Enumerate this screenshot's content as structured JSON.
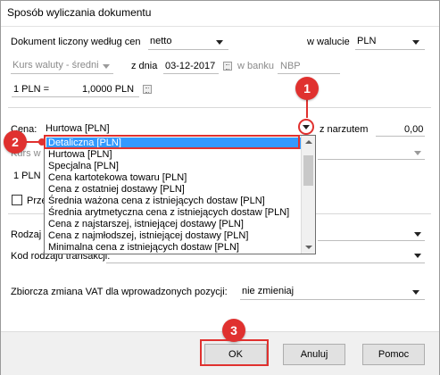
{
  "window": {
    "title": "Sposób wyliczania dokumentu"
  },
  "row1": {
    "label": "Dokument liczony według cen",
    "mode_value": "netto",
    "currency_label": "w walucie",
    "currency_value": "PLN"
  },
  "row2": {
    "rate_type_value": "Kurs waluty - średni",
    "date_label": "z dnia",
    "date_value": "03-12-2017",
    "bank_label": "w banku",
    "bank_value": "NBP"
  },
  "row3": {
    "rate_left": "1 PLN =",
    "rate_value": "1,0000 PLN"
  },
  "price": {
    "label": "Cena:",
    "value": "Hurtowa [PLN]",
    "markup_label": "z narzutem",
    "markup_value": "0,00"
  },
  "hidden_rows": {
    "kurs_partial": "Kurs w",
    "rate_partial": "1 PLN =",
    "checkbox_partial": "Prze",
    "rodzaj_partial": "Rodzaj",
    "kod_label": "Kod rodzaju transakcji:"
  },
  "dropdown": {
    "items": [
      "Detaliczna [PLN]",
      "Hurtowa [PLN]",
      "Specjalna [PLN]",
      "Cena kartotekowa towaru [PLN]",
      "Cena z ostatniej dostawy [PLN]",
      "Średnia ważona cena z istniejących dostaw [PLN]",
      "Średnia arytmetyczna cena z istniejących dostaw [PLN]",
      "Cena z najstarszej, istniejącej dostawy [PLN]",
      "Cena z najmłodszej, istniejącej dostawy [PLN]",
      "Minimalna cena z istniejących dostaw [PLN]"
    ],
    "selected_index": 0
  },
  "vat": {
    "label": "Zbiorcza zmiana VAT dla wprowadzonych pozycji:",
    "value": "nie zmieniaj"
  },
  "buttons": {
    "ok": "OK",
    "cancel": "Anuluj",
    "help": "Pomoc"
  },
  "annotations": {
    "m1": "1",
    "m2": "2",
    "m3": "3"
  },
  "colors": {
    "accent": "#e0312f",
    "selection": "#3399ff"
  }
}
